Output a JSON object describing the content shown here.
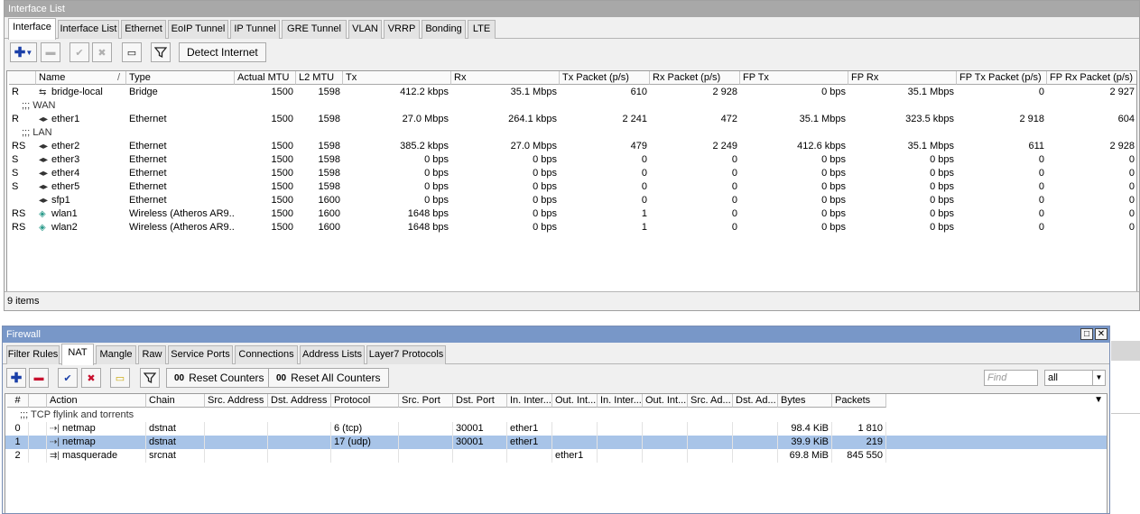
{
  "interface_window": {
    "title": "Interface List",
    "tabs": [
      "Interface",
      "Interface List",
      "Ethernet",
      "EoIP Tunnel",
      "IP Tunnel",
      "GRE Tunnel",
      "VLAN",
      "VRRP",
      "Bonding",
      "LTE"
    ],
    "active_tab": "Interface",
    "toolbar": {
      "detect_label": "Detect Internet"
    },
    "columns": [
      "",
      "Name",
      "Type",
      "Actual MTU",
      "L2 MTU",
      "Tx",
      "Rx",
      "Tx Packet (p/s)",
      "Rx Packet (p/s)",
      "FP Tx",
      "FP Rx",
      "FP Tx Packet (p/s)",
      "FP Rx Packet (p/s)"
    ],
    "sort_indicator": "/",
    "rows": [
      {
        "kind": "data",
        "flag": "R",
        "icon": "bridge-icon",
        "name": "bridge-local",
        "type": "Bridge",
        "amtu": "1500",
        "l2mtu": "1598",
        "tx": "412.2 kbps",
        "rx": "35.1 Mbps",
        "txp": "610",
        "rxp": "2 928",
        "fptx": "0 bps",
        "fprx": "35.1 Mbps",
        "fptxp": "0",
        "fprxp": "2 927"
      },
      {
        "kind": "comment",
        "text": ";;; WAN"
      },
      {
        "kind": "data",
        "flag": "R",
        "icon": "ethernet-icon",
        "name": "ether1",
        "type": "Ethernet",
        "amtu": "1500",
        "l2mtu": "1598",
        "tx": "27.0 Mbps",
        "rx": "264.1 kbps",
        "txp": "2 241",
        "rxp": "472",
        "fptx": "35.1 Mbps",
        "fprx": "323.5 kbps",
        "fptxp": "2 918",
        "fprxp": "604"
      },
      {
        "kind": "comment",
        "text": ";;; LAN"
      },
      {
        "kind": "data",
        "flag": "RS",
        "icon": "ethernet-icon",
        "name": "ether2",
        "type": "Ethernet",
        "amtu": "1500",
        "l2mtu": "1598",
        "tx": "385.2 kbps",
        "rx": "27.0 Mbps",
        "txp": "479",
        "rxp": "2 249",
        "fptx": "412.6 kbps",
        "fprx": "35.1 Mbps",
        "fptxp": "611",
        "fprxp": "2 928"
      },
      {
        "kind": "data",
        "flag": "S",
        "icon": "ethernet-icon",
        "name": "ether3",
        "type": "Ethernet",
        "amtu": "1500",
        "l2mtu": "1598",
        "tx": "0 bps",
        "rx": "0 bps",
        "txp": "0",
        "rxp": "0",
        "fptx": "0 bps",
        "fprx": "0 bps",
        "fptxp": "0",
        "fprxp": "0"
      },
      {
        "kind": "data",
        "flag": "S",
        "icon": "ethernet-icon",
        "name": "ether4",
        "type": "Ethernet",
        "amtu": "1500",
        "l2mtu": "1598",
        "tx": "0 bps",
        "rx": "0 bps",
        "txp": "0",
        "rxp": "0",
        "fptx": "0 bps",
        "fprx": "0 bps",
        "fptxp": "0",
        "fprxp": "0"
      },
      {
        "kind": "data",
        "flag": "S",
        "icon": "ethernet-icon",
        "name": "ether5",
        "type": "Ethernet",
        "amtu": "1500",
        "l2mtu": "1598",
        "tx": "0 bps",
        "rx": "0 bps",
        "txp": "0",
        "rxp": "0",
        "fptx": "0 bps",
        "fprx": "0 bps",
        "fptxp": "0",
        "fprxp": "0"
      },
      {
        "kind": "data",
        "flag": "",
        "icon": "ethernet-icon",
        "name": "sfp1",
        "type": "Ethernet",
        "amtu": "1500",
        "l2mtu": "1600",
        "tx": "0 bps",
        "rx": "0 bps",
        "txp": "0",
        "rxp": "0",
        "fptx": "0 bps",
        "fprx": "0 bps",
        "fptxp": "0",
        "fprxp": "0"
      },
      {
        "kind": "data",
        "flag": "RS",
        "icon": "wireless-icon",
        "name": "wlan1",
        "type": "Wireless (Atheros AR9...",
        "amtu": "1500",
        "l2mtu": "1600",
        "tx": "1648 bps",
        "rx": "0 bps",
        "txp": "1",
        "rxp": "0",
        "fptx": "0 bps",
        "fprx": "0 bps",
        "fptxp": "0",
        "fprxp": "0"
      },
      {
        "kind": "data",
        "flag": "RS",
        "icon": "wireless-icon",
        "name": "wlan2",
        "type": "Wireless (Atheros AR9...",
        "amtu": "1500",
        "l2mtu": "1600",
        "tx": "1648 bps",
        "rx": "0 bps",
        "txp": "1",
        "rxp": "0",
        "fptx": "0 bps",
        "fprx": "0 bps",
        "fptxp": "0",
        "fprxp": "0"
      }
    ],
    "status": "9 items"
  },
  "firewall_window": {
    "title": "Firewall",
    "tabs": [
      "Filter Rules",
      "NAT",
      "Mangle",
      "Raw",
      "Service Ports",
      "Connections",
      "Address Lists",
      "Layer7 Protocols"
    ],
    "active_tab": "NAT",
    "toolbar": {
      "reset_counters": "Reset Counters",
      "reset_all_counters": "Reset All Counters",
      "counter_glyph": "00",
      "find_placeholder": "Find",
      "filter_value": "all"
    },
    "columns": [
      "#",
      "",
      "Action",
      "Chain",
      "Src. Address",
      "Dst. Address",
      "Protocol",
      "Src. Port",
      "Dst. Port",
      "In. Inter...",
      "Out. Int...",
      "In. Inter...",
      "Out. Int...",
      "Src. Ad...",
      "Dst. Ad...",
      "Bytes",
      "Packets"
    ],
    "rows": [
      {
        "kind": "comment",
        "text": ";;; TCP flylink and torrents"
      },
      {
        "kind": "data",
        "num": "0",
        "action": "netmap",
        "chain": "dstnat",
        "protocol": "6 (tcp)",
        "dstport": "30001",
        "inif": "ether1",
        "outif": "",
        "bytes": "98.4 KiB",
        "packets": "1 810",
        "selected": false
      },
      {
        "kind": "data",
        "num": "1",
        "action": "netmap",
        "chain": "dstnat",
        "protocol": "17 (udp)",
        "dstport": "30001",
        "inif": "ether1",
        "outif": "",
        "bytes": "39.9 KiB",
        "packets": "219",
        "selected": true
      },
      {
        "kind": "data",
        "num": "2",
        "action": "masquerade",
        "chain": "srcnat",
        "protocol": "",
        "dstport": "",
        "inif": "",
        "outif": "ether1",
        "bytes": "69.8 MiB",
        "packets": "845 550",
        "selected": false
      }
    ]
  }
}
